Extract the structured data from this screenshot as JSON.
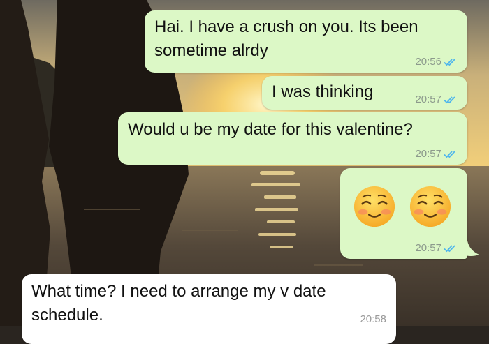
{
  "chat": {
    "messages": [
      {
        "id": "m1",
        "direction": "outgoing",
        "lines": [
          "Hai. I have a crush on you. Its been",
          "sometime alrdy"
        ],
        "time": "20:56",
        "status": "read"
      },
      {
        "id": "m2",
        "direction": "outgoing",
        "lines": [
          "I was thinking"
        ],
        "time": "20:57",
        "status": "read"
      },
      {
        "id": "m3",
        "direction": "outgoing",
        "lines": [
          "Would u be my date for this valentine?"
        ],
        "time": "20:57",
        "status": "read"
      },
      {
        "id": "m4",
        "direction": "outgoing",
        "emoji": [
          "smiling-face-with-smiling-eyes",
          "smiling-face-with-smiling-eyes"
        ],
        "time": "20:57",
        "status": "read"
      },
      {
        "id": "m5",
        "direction": "incoming",
        "lines": [
          "What time? I need to arrange my v date",
          "schedule."
        ],
        "time": "20:58"
      }
    ]
  },
  "colors": {
    "outgoing_bubble": "#dcf8c6",
    "incoming_bubble": "#ffffff",
    "read_ticks": "#4fb6ec",
    "timestamp": "#8c9a8c"
  },
  "icons": {
    "read_receipt": "double-check-icon",
    "emoji": "smiling-face-emoji"
  }
}
